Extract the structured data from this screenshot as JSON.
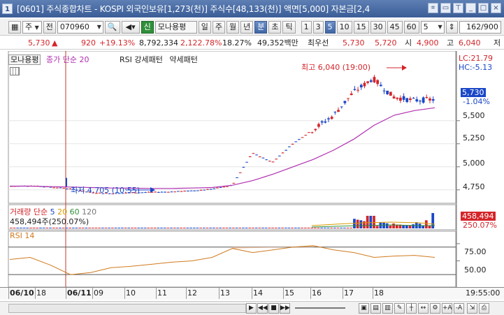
{
  "window": {
    "icon_label": "1",
    "title": "[0601] 주식종합차트 - KOSPI 외국인보유[1,273(천)] 주식수[48,133(천)] 액면[5,000] 자본금[2,4"
  },
  "toolbar": {
    "market": "주",
    "scope": "전",
    "code": "070960",
    "credit_badge": "신",
    "stock_name": "모나용평",
    "period_tabs": [
      "일",
      "주",
      "월",
      "년",
      "분",
      "초",
      "틱"
    ],
    "active_period": "분",
    "minute_buttons": [
      "1",
      "3",
      "5",
      "10",
      "15",
      "30",
      "45",
      "60"
    ],
    "active_minute": "5",
    "interval_value": "5",
    "count": "162",
    "count_total": "/900"
  },
  "price": {
    "current": "5,730",
    "change": "920",
    "change_rate": "+19.13%",
    "volume": "8,792,334",
    "volume_ratio": "2,122.78%",
    "turnover": "18.27%",
    "amount": "49,352백만",
    "best_label": "최우선",
    "ask": "5,730",
    "bid": "5,720",
    "open_label": "시",
    "open": "4,900",
    "high_label": "고",
    "high": "6,040",
    "low_label": "저"
  },
  "chart": {
    "legend_stock": "모나용평",
    "legend_ma": "종가 단순 20",
    "legend_rsi": "RSI 강세패턴",
    "legend_rsi2": "약세패턴",
    "max_label": "최고 6,040 (19:00)",
    "min_label": "최저 4,705 (10:55)",
    "lc": "LC:21.79",
    "hc": "HC:-5.13",
    "price_tag": "5,730",
    "price_pct": "-1.04%",
    "y_ticks": [
      "5,500",
      "5,250",
      "5,000",
      "4,750"
    ],
    "volume_legend": "거래량 단순",
    "volume_ma": [
      "5",
      "20",
      "60",
      "120"
    ],
    "volume_value": "458,494주(250.07%)",
    "volume_tag": "458,494",
    "volume_pct": "250.07%",
    "rsi_label": "RSI 14",
    "rsi_ticks": [
      "75.00",
      "50.00"
    ],
    "x_labels": [
      "06/10",
      "18",
      "06/11",
      "09",
      "10",
      "11",
      "12",
      "13",
      "14",
      "15",
      "16",
      "17",
      "18"
    ],
    "time_label": "19:55:00"
  },
  "colors": {
    "up": "#d4252a",
    "down": "#1a47c7",
    "ma": "#b02fb0",
    "rsi_line": "#d07a1e",
    "rsi_fill": "#f0b58c"
  },
  "chart_data": {
    "type": "candlestick",
    "title": "",
    "y_unit": "KRW",
    "ylim": [
      4650,
      6150
    ],
    "ma20": [
      4790,
      4790,
      4785,
      4780,
      4775,
      4770,
      4768,
      4765,
      4765,
      4770,
      4775,
      4800,
      4850,
      4920,
      5000,
      5080,
      5180,
      5300,
      5450,
      5560,
      5610,
      5640
    ],
    "price_series": [
      4790,
      4795,
      4780,
      4760,
      4720,
      4710,
      4720,
      4725,
      4730,
      4740,
      4760,
      4800,
      5150,
      5050,
      5250,
      5400,
      5550,
      5800,
      5960,
      5760,
      5720,
      5730
    ],
    "rsi": [
      52,
      55,
      44,
      30,
      33,
      40,
      42,
      45,
      48,
      50,
      55,
      68,
      62,
      66,
      70,
      72,
      66,
      62,
      55,
      57,
      58,
      55
    ]
  }
}
